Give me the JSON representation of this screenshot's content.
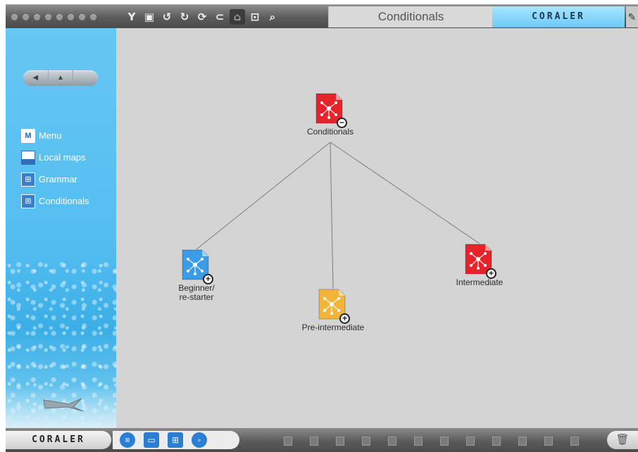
{
  "toolbar": {
    "tools": [
      {
        "name": "filter-icon",
        "glyph": "Y"
      },
      {
        "name": "save-icon",
        "glyph": "▣"
      },
      {
        "name": "undo-icon",
        "glyph": "↺"
      },
      {
        "name": "redo-icon",
        "glyph": "↻"
      },
      {
        "name": "refresh-icon",
        "glyph": "⟳"
      },
      {
        "name": "link-icon",
        "glyph": "⊂"
      },
      {
        "name": "print-icon",
        "glyph": "⌂"
      },
      {
        "name": "fit-icon",
        "glyph": "⊡"
      },
      {
        "name": "zoom-icon",
        "glyph": "⌕"
      }
    ],
    "map_title": "Conditionals",
    "brand": "CORALER",
    "edit_glyph": "✎"
  },
  "sidebar": {
    "nav": {
      "back": "◀",
      "up": "▲",
      "forward": ""
    },
    "links": [
      {
        "label": "Menu",
        "icon": "menu-icon",
        "glyph": "M"
      },
      {
        "label": "Local maps",
        "icon": "monitor-icon",
        "glyph": ""
      },
      {
        "label": "Grammar",
        "icon": "map-icon",
        "glyph": "⊞"
      },
      {
        "label": "Conditionals",
        "icon": "map-icon",
        "glyph": "⊞"
      }
    ]
  },
  "map": {
    "nodes": [
      {
        "id": "conditionals",
        "label": "Conditionals",
        "color": "#e8222a",
        "badge": "−"
      },
      {
        "id": "beginner",
        "label": "Beginner/\nre-starter",
        "color": "#3a9be6",
        "badge": "+"
      },
      {
        "id": "pre-intermediate",
        "label": "Pre-intermediate",
        "color": "#f2b53a",
        "badge": "+"
      },
      {
        "id": "intermediate",
        "label": "Intermediate",
        "color": "#e8222a",
        "badge": "+"
      }
    ],
    "edges": [
      [
        "conditionals",
        "beginner"
      ],
      [
        "conditionals",
        "pre-intermediate"
      ],
      [
        "conditionals",
        "intermediate"
      ]
    ]
  },
  "bottombar": {
    "brand": "CORALER",
    "icons": [
      {
        "name": "list-icon",
        "glyph": "≡"
      },
      {
        "name": "window-icon",
        "glyph": "▭"
      },
      {
        "name": "map-view-icon",
        "glyph": "⊞"
      },
      {
        "name": "info-icon",
        "glyph": "▫"
      }
    ],
    "trash_glyph": "🗑"
  }
}
